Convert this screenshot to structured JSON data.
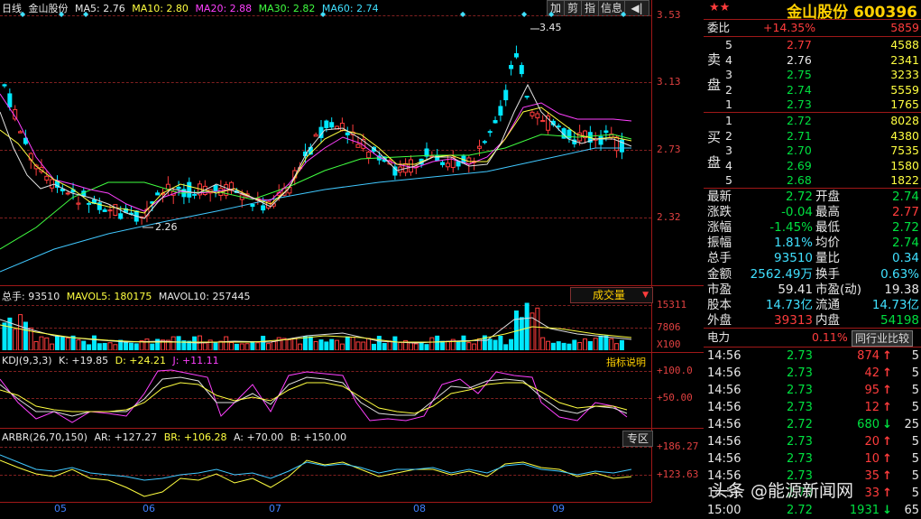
{
  "header": {
    "period": "日线",
    "name": "金山股份",
    "ma5": "MA5: 2.76",
    "ma10": "MA10: 2.80",
    "ma20": "MA20: 2.88",
    "ma30": "MA30: 2.82",
    "ma60": "MA60: 2.74"
  },
  "toolbar": {
    "add": "加",
    "remove": "剪",
    "index": "指",
    "info": "信息"
  },
  "price_axis": [
    "3.53",
    "3.13",
    "2.73",
    "2.32"
  ],
  "annotations": {
    "high": "3.45",
    "low": "2.26"
  },
  "volume": {
    "label": "总手: 93510",
    "mavol5": "MAVOL5: 180175",
    "mavol10": "MAVOL10: 257445",
    "selector": "成交量",
    "axis": [
      "15311",
      "7806",
      "X100"
    ]
  },
  "kdj": {
    "label": "KDJ(9,3,3)",
    "k": "K: +19.85",
    "d": "D: +24.21",
    "j": "J: +11.11",
    "help": "指标说明",
    "axis": [
      "+100.0",
      "+50.00"
    ]
  },
  "arbr": {
    "label": "ARBR(26,70,150)",
    "ar": "AR: +127.27",
    "br": "BR: +106.28",
    "a": "A: +70.00",
    "b": "B: +150.00",
    "tab": "专区",
    "axis": [
      "+186.27",
      "+123.63"
    ]
  },
  "months": [
    "05",
    "06",
    "07",
    "08",
    "09"
  ],
  "quote": {
    "title": "金山股份 600396",
    "weibi_label": "委比",
    "weibi": "+14.35%",
    "weibi_vol": "5859",
    "sell_label": "卖盘",
    "buy_label": "买盘",
    "sells": [
      {
        "lv": "5",
        "price": "2.77",
        "vol": "4588",
        "color": "red"
      },
      {
        "lv": "4",
        "price": "2.76",
        "vol": "2341",
        "color": "white"
      },
      {
        "lv": "3",
        "price": "2.75",
        "vol": "3233",
        "color": "green"
      },
      {
        "lv": "2",
        "price": "2.74",
        "vol": "5559",
        "color": "green"
      },
      {
        "lv": "1",
        "price": "2.73",
        "vol": "1765",
        "color": "green"
      }
    ],
    "buys": [
      {
        "lv": "1",
        "price": "2.72",
        "vol": "8028",
        "color": "green"
      },
      {
        "lv": "2",
        "price": "2.71",
        "vol": "4380",
        "color": "green"
      },
      {
        "lv": "3",
        "price": "2.70",
        "vol": "7535",
        "color": "green"
      },
      {
        "lv": "4",
        "price": "2.69",
        "vol": "1580",
        "color": "green"
      },
      {
        "lv": "5",
        "price": "2.68",
        "vol": "1822",
        "color": "green"
      }
    ],
    "stats": [
      {
        "l1": "最新",
        "v1": "2.72",
        "c1": "green",
        "l2": "开盘",
        "v2": "2.74",
        "c2": "green"
      },
      {
        "l1": "涨跌",
        "v1": "-0.04",
        "c1": "green",
        "l2": "最高",
        "v2": "2.77",
        "c2": "red"
      },
      {
        "l1": "涨幅",
        "v1": "-1.45%",
        "c1": "green",
        "l2": "最低",
        "v2": "2.72",
        "c2": "green"
      },
      {
        "l1": "振幅",
        "v1": "1.81%",
        "c1": "cyan",
        "l2": "均价",
        "v2": "2.74",
        "c2": "green"
      },
      {
        "l1": "总手",
        "v1": "93510",
        "c1": "cyan",
        "l2": "量比",
        "v2": "0.34",
        "c2": "cyan"
      },
      {
        "l1": "金额",
        "v1": "2562.49万",
        "c1": "cyan",
        "l2": "换手",
        "v2": "0.63%",
        "c2": "cyan"
      },
      {
        "l1": "市盈",
        "v1": "59.41",
        "c1": "white",
        "l2": "市盈(动)",
        "v2": "19.38",
        "c2": "white"
      },
      {
        "l1": "股本",
        "v1": "14.73亿",
        "c1": "cyan",
        "l2": "流通",
        "v2": "14.73亿",
        "c2": "cyan"
      },
      {
        "l1": "外盘",
        "v1": "39313",
        "c1": "red",
        "l2": "内盘",
        "v2": "54198",
        "c2": "green"
      }
    ],
    "sector": "电力",
    "sector_pct": "0.11%",
    "compare_btn": "同行业比较",
    "ticks": [
      {
        "t": "14:56",
        "p": "2.73",
        "v": "874",
        "dir": "up",
        "x": "5"
      },
      {
        "t": "14:56",
        "p": "2.73",
        "v": "42",
        "dir": "up",
        "x": "5"
      },
      {
        "t": "14:56",
        "p": "2.73",
        "v": "95",
        "dir": "up",
        "x": "5"
      },
      {
        "t": "14:56",
        "p": "2.73",
        "v": "12",
        "dir": "up",
        "x": "5"
      },
      {
        "t": "14:56",
        "p": "2.72",
        "v": "680",
        "dir": "down",
        "x": "25"
      },
      {
        "t": "14:56",
        "p": "2.73",
        "v": "20",
        "dir": "up",
        "x": "5"
      },
      {
        "t": "14:56",
        "p": "2.73",
        "v": "10",
        "dir": "up",
        "x": "5"
      },
      {
        "t": "14:56",
        "p": "2.73",
        "v": "35",
        "dir": "up",
        "x": "5"
      },
      {
        "t": "14:56",
        "p": "2.73",
        "v": "33",
        "dir": "up",
        "x": "5"
      },
      {
        "t": "15:00",
        "p": "2.72",
        "v": "1931",
        "dir": "down",
        "x": "65"
      }
    ]
  },
  "watermark": "头条 @能源新闻网",
  "colors": {
    "up": "#ff3c3c",
    "down": "#00e8ff",
    "bg": "#000000",
    "grid": "#a01818"
  }
}
